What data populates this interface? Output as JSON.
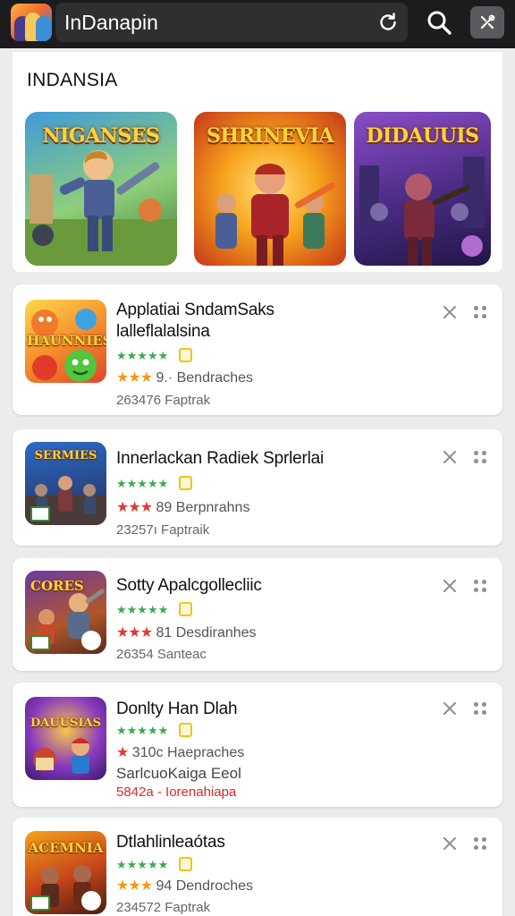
{
  "header": {
    "app_title": "InDanapin",
    "logo_icon": "game-logo-icon",
    "refresh_icon": "refresh-icon",
    "search_icon": "search-icon",
    "tools_icon": "tools-icon"
  },
  "featured": {
    "heading": "INDANSIA",
    "tiles": [
      {
        "title": "NIGANSES",
        "colors": [
          "#3e9bd9",
          "#7cc46a"
        ]
      },
      {
        "title": "SHRINEVIA",
        "colors": [
          "#f7b21b",
          "#d6421b"
        ]
      },
      {
        "title": "DIDAUUIS",
        "colors": [
          "#7a3fb8",
          "#2b1e5e"
        ]
      }
    ]
  },
  "apps": [
    {
      "name_line1": "Applatiai SndamSaks",
      "name_line2": "lalleflalalsina",
      "thumb_title": "HAUNNIES",
      "stars": "★★★★★",
      "rating_stars": "★★★",
      "rating_text": "9.·  Bendraches",
      "meta": "263476 Faptrak"
    },
    {
      "name_line1": "Innerlackan Radiek Sprlerlai",
      "thumb_title": "SERMIES",
      "stars": "★★★★★",
      "rating_stars": "★★★",
      "rating_text": "89  Berpnrahns",
      "meta": "23257ı Faptraik"
    },
    {
      "name_line1": "Sotty Apalcgollecliic",
      "thumb_title": "CORES",
      "stars": "★★★★★",
      "rating_stars": "★★★",
      "rating_text": "81  Desdiranhes",
      "meta": "26354 Santeac"
    },
    {
      "name_line1": "Donlty Han Dlah",
      "thumb_title": "DAUUSIAS",
      "stars": "★★★★★",
      "rating_stars": "★",
      "rating_text": "310c  Haepraches",
      "subtitle": "SarlcuoKaiga Eeol",
      "promo": "5842a - Iorenahiapa"
    },
    {
      "name_line1": "Dtlahlinleaótas",
      "thumb_title": "ACEMNIA",
      "stars": "★★★★★",
      "rating_stars": "★★★",
      "rating_text": "94  Dendroches",
      "meta": "234572 Faptrak"
    }
  ],
  "colors": {
    "topbar": "#1c1c1e",
    "star_green": "#3bab4d",
    "promo_red": "#e0282c"
  }
}
